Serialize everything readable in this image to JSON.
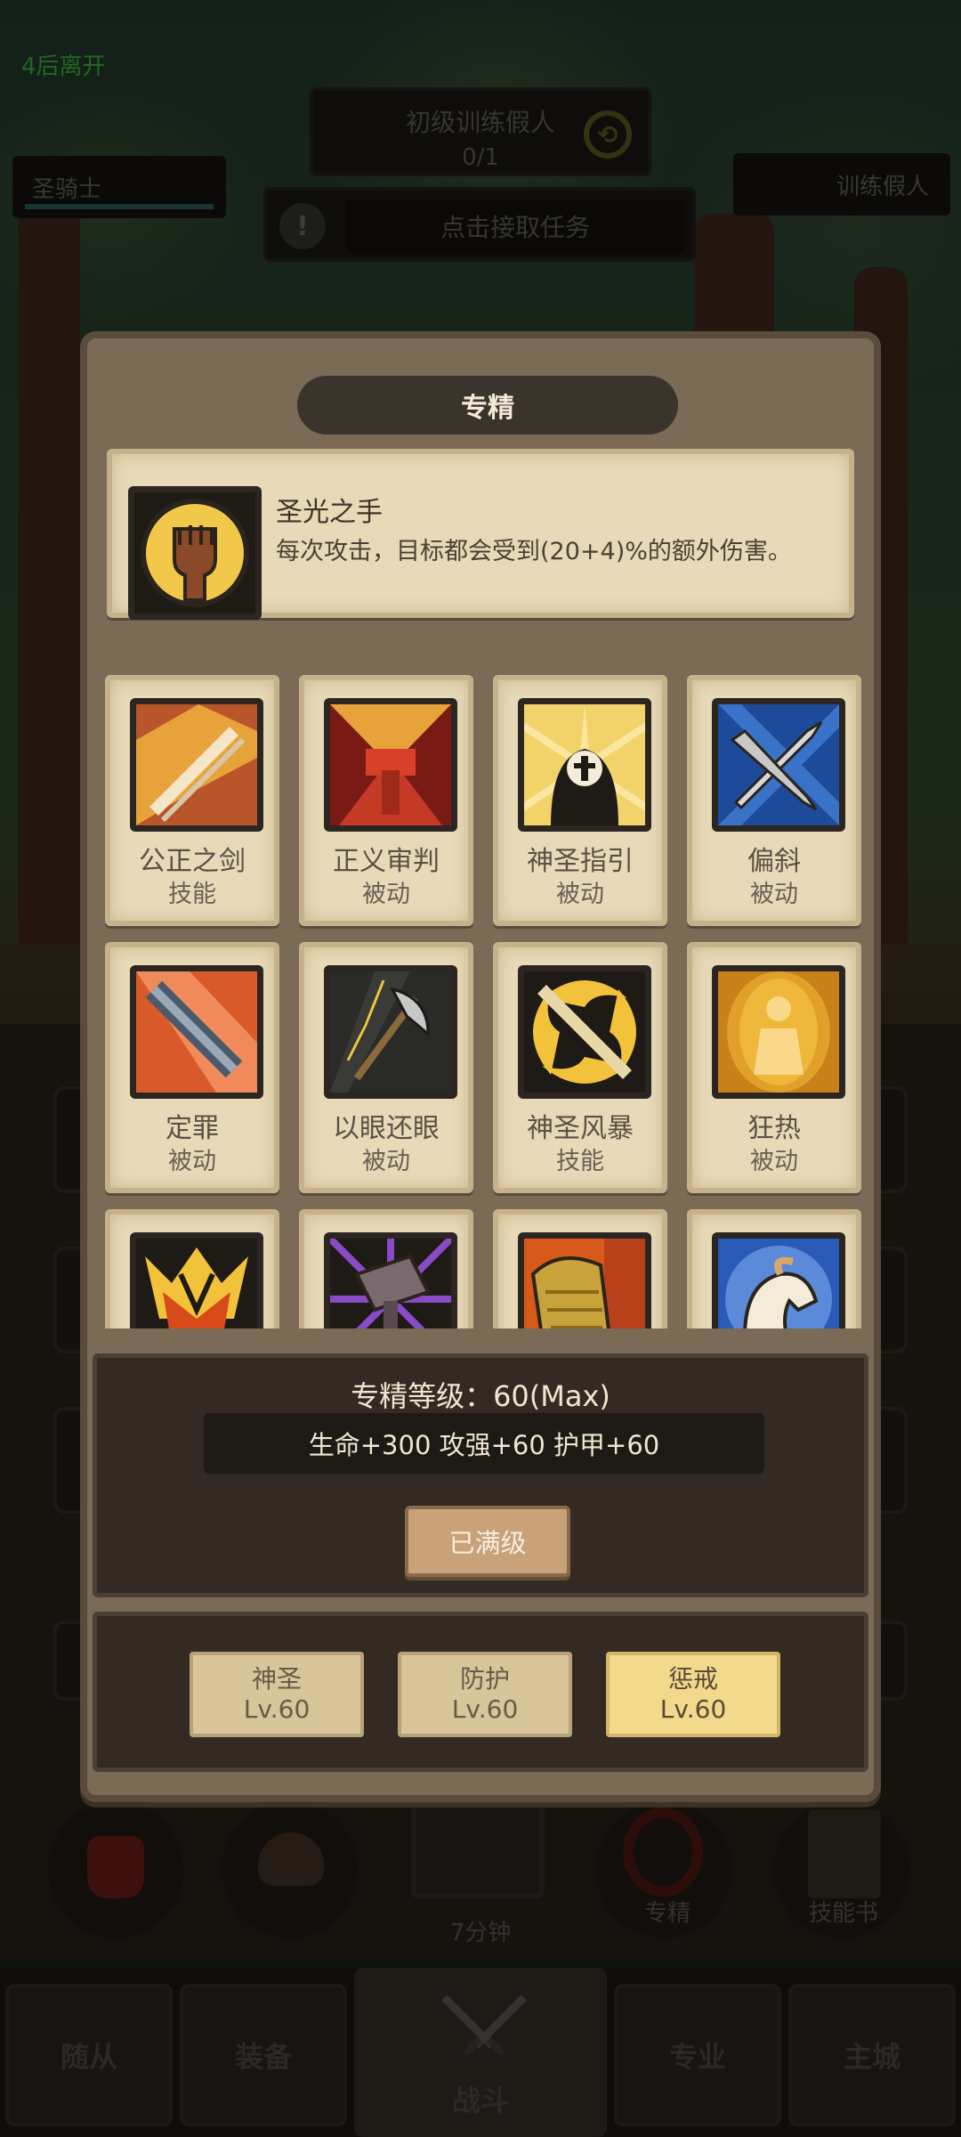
{
  "hud": {
    "exit_timer": "4后离开",
    "quest_title": "初级训练假人",
    "quest_progress": "0/1",
    "accept_task": "点击接取任务",
    "player_name": "圣骑士",
    "enemy_name": "训练假人"
  },
  "modal": {
    "title": "专精",
    "selected": {
      "name": "圣光之手",
      "description": "每次攻击，目标都会受到(20+4)%的额外伤害。"
    },
    "skills": [
      {
        "name": "公正之剑",
        "type": "技能",
        "icon": "sword-gold-icon"
      },
      {
        "name": "正义审判",
        "type": "被动",
        "icon": "judgement-hammer-icon"
      },
      {
        "name": "神圣指引",
        "type": "被动",
        "icon": "holy-guidance-icon"
      },
      {
        "name": "偏斜",
        "type": "被动",
        "icon": "crossed-swords-icon"
      },
      {
        "name": "定罪",
        "type": "被动",
        "icon": "conviction-sword-icon"
      },
      {
        "name": "以眼还眼",
        "type": "被动",
        "icon": "retaliation-axe-icon"
      },
      {
        "name": "神圣风暴",
        "type": "技能",
        "icon": "divine-storm-icon"
      },
      {
        "name": "狂热",
        "type": "被动",
        "icon": "zeal-figure-icon"
      },
      {
        "name": "",
        "type": "",
        "icon": "lion-crest-icon"
      },
      {
        "name": "",
        "type": "",
        "icon": "purple-hammer-icon"
      },
      {
        "name": "",
        "type": "",
        "icon": "golden-gauntlet-icon"
      },
      {
        "name": "",
        "type": "",
        "icon": "white-horse-icon"
      }
    ],
    "level_title": "专精等级：60(Max)",
    "stats": "生命+300  攻强+60  护甲+60",
    "maxed_label": "已满级",
    "trees": [
      {
        "name": "神圣",
        "level": "Lv.60",
        "active": false
      },
      {
        "name": "防护",
        "level": "Lv.60",
        "active": false
      },
      {
        "name": "惩戒",
        "level": "Lv.60",
        "active": true
      }
    ]
  },
  "behind": {
    "timer_label": "7分钟",
    "spec_label": "专精",
    "skillbook_label": "技能书"
  },
  "nav": {
    "followers": "随从",
    "equipment": "装备",
    "battle": "战斗",
    "profession": "专业",
    "main_city": "主城"
  }
}
